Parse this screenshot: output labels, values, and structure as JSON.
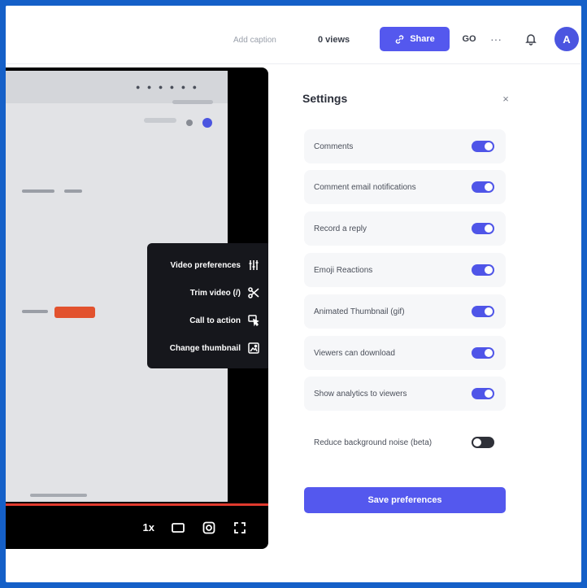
{
  "topbar": {
    "add_caption": "Add caption",
    "views": "0 views",
    "share_label": "Share",
    "go_label": "GO",
    "more_label": "···",
    "avatar_initial": "A",
    "accent_color": "#5458ee"
  },
  "player": {
    "speed_label": "1x",
    "progress_color": "#e03a2e",
    "menu": [
      {
        "label": "Video preferences",
        "icon": "sliders-icon"
      },
      {
        "label": "Trim video (/)",
        "icon": "scissors-icon"
      },
      {
        "label": "Call to action",
        "icon": "cursor-click-icon"
      },
      {
        "label": "Change thumbnail",
        "icon": "image-icon"
      }
    ]
  },
  "settings": {
    "title": "Settings",
    "close_label": "×",
    "options": [
      {
        "label": "Comments",
        "enabled": true
      },
      {
        "label": "Comment email notifications",
        "enabled": true
      },
      {
        "label": "Record a reply",
        "enabled": true
      },
      {
        "label": "Emoji Reactions",
        "enabled": true
      },
      {
        "label": "Animated Thumbnail (gif)",
        "enabled": true
      },
      {
        "label": "Viewers can download",
        "enabled": true
      },
      {
        "label": "Show analytics to viewers",
        "enabled": true
      },
      {
        "label": "Reduce background noise (beta)",
        "enabled": false
      }
    ],
    "save_label": "Save preferences"
  }
}
